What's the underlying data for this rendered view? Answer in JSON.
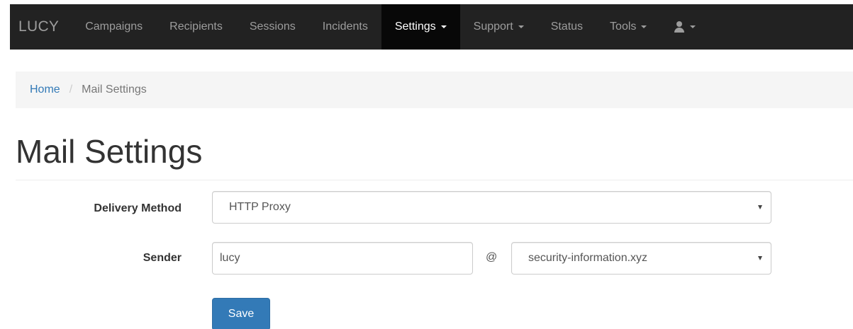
{
  "navbar": {
    "brand": "LUCY",
    "items": [
      {
        "label": "Campaigns",
        "dropdown": false,
        "active": false
      },
      {
        "label": "Recipients",
        "dropdown": false,
        "active": false
      },
      {
        "label": "Sessions",
        "dropdown": false,
        "active": false
      },
      {
        "label": "Incidents",
        "dropdown": false,
        "active": false
      },
      {
        "label": "Settings",
        "dropdown": true,
        "active": true
      },
      {
        "label": "Support",
        "dropdown": true,
        "active": false
      },
      {
        "label": "Status",
        "dropdown": false,
        "active": false
      },
      {
        "label": "Tools",
        "dropdown": true,
        "active": false
      }
    ],
    "user_menu": {
      "icon": "user-icon",
      "dropdown": true
    },
    "colors": {
      "background": "#222222",
      "active_background": "#080808",
      "text": "#9d9d9d",
      "active_text": "#ffffff"
    }
  },
  "breadcrumb": {
    "home": "Home",
    "separator": "/",
    "current": "Mail Settings"
  },
  "page": {
    "title": "Mail Settings"
  },
  "form": {
    "delivery_method": {
      "label": "Delivery Method",
      "selected": "HTTP Proxy"
    },
    "sender": {
      "label": "Sender",
      "local_part": "lucy",
      "at": "@",
      "domain_selected": "security-information.xyz"
    },
    "save_label": "Save"
  },
  "colors": {
    "link": "#337ab7",
    "primary_button": "#337ab7"
  }
}
